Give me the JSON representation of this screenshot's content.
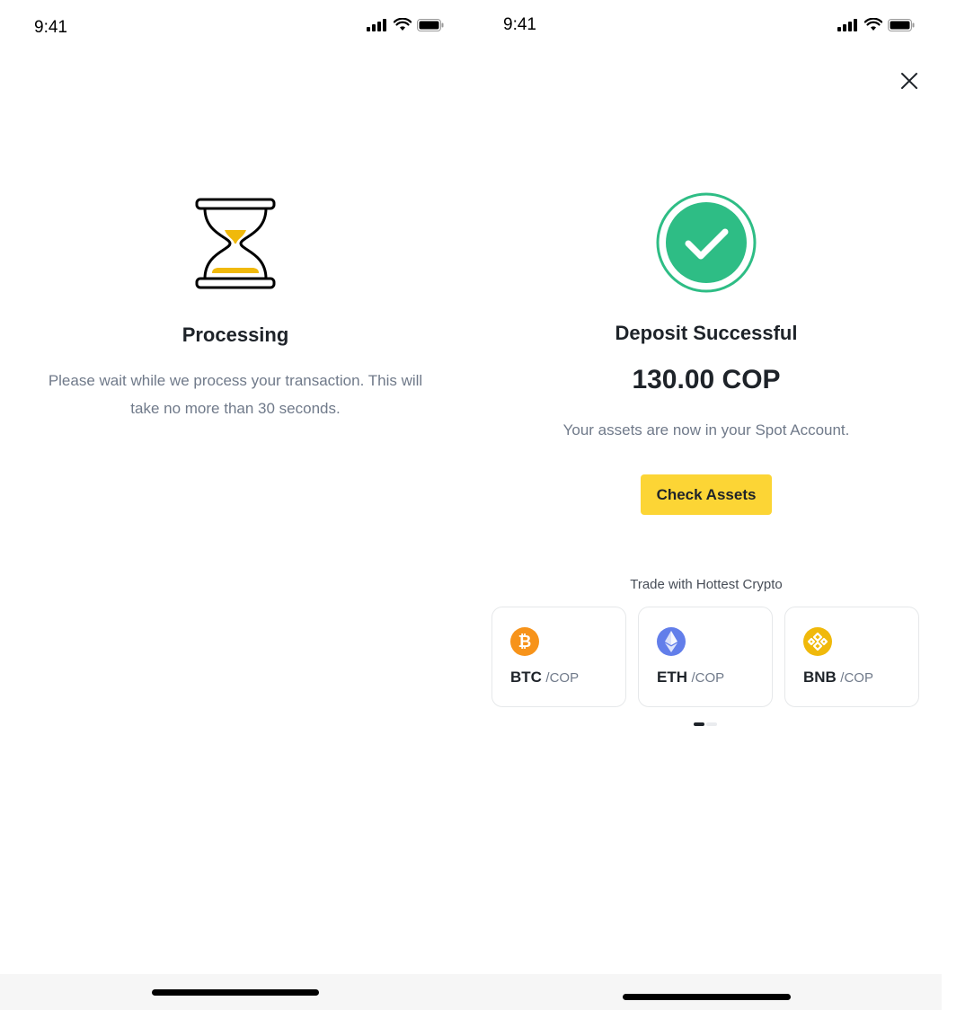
{
  "left_screen": {
    "status": {
      "time": "9:41"
    },
    "title": "Processing",
    "message_line1": "Please wait while we process your transaction. This will",
    "message_line2": "take no more than 30 seconds.",
    "icon": "hourglass-icon"
  },
  "right_screen": {
    "status": {
      "time": "9:41"
    },
    "close_icon": "close-icon",
    "success_icon": "check-circle-icon",
    "title": "Deposit Successful",
    "amount": "130.00 COP",
    "message": "Your assets are now in your  Spot Account.",
    "button_label": "Check Assets",
    "section_title": "Trade with Hottest Crypto",
    "cards": [
      {
        "base": "BTC",
        "quote": "/COP",
        "icon": "bitcoin-icon",
        "color": "#f7931a"
      },
      {
        "base": "ETH",
        "quote": "/COP",
        "icon": "ethereum-icon",
        "color": "#627eea"
      },
      {
        "base": "BNB",
        "quote": "/COP",
        "icon": "bnb-icon",
        "color": "#f0b90b"
      }
    ],
    "pager": {
      "active_index": 0,
      "count": 2
    }
  },
  "colors": {
    "accent_yellow": "#fcd535",
    "success_green": "#2ebd85",
    "text_primary": "#1e2329",
    "text_secondary": "#707a8a"
  }
}
